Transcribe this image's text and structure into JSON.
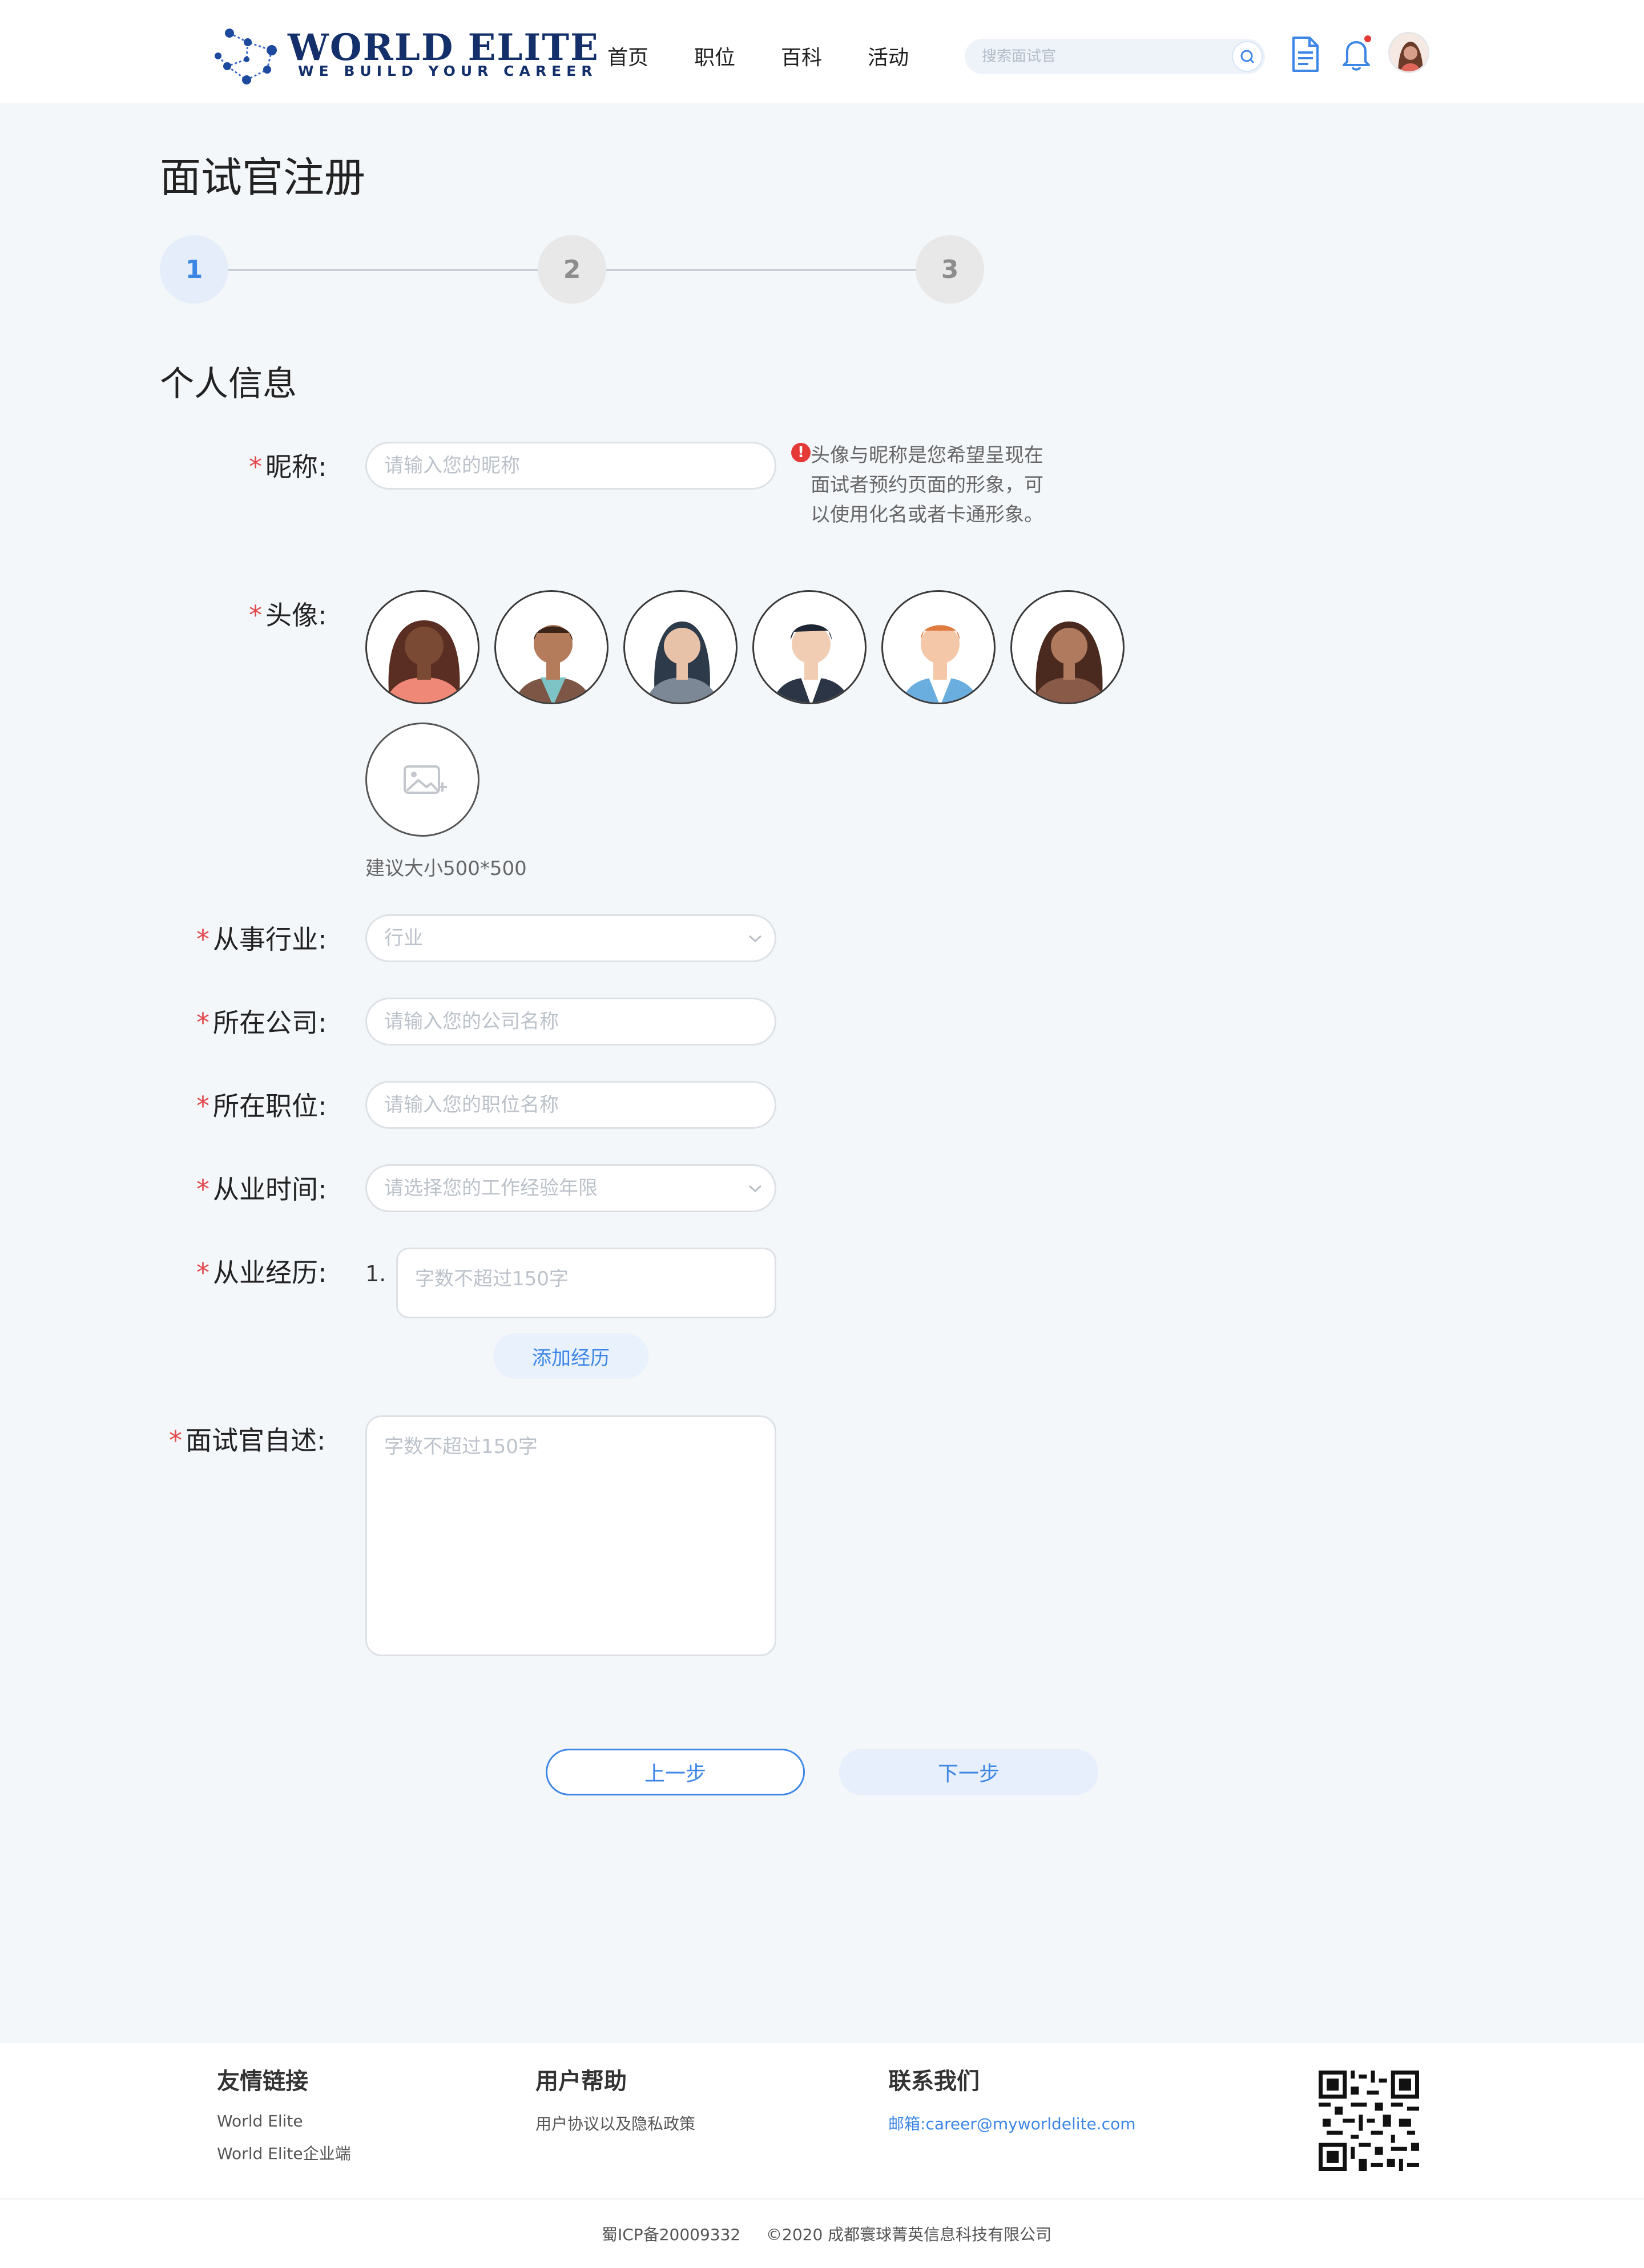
{
  "header": {
    "logo_title": "WORLD ELITE",
    "logo_subtitle": "WE BUILD YOUR CAREER",
    "nav": [
      "首页",
      "职位",
      "百科",
      "活动"
    ],
    "search_placeholder": "搜索面试官"
  },
  "page": {
    "title": "面试官注册",
    "steps": [
      "1",
      "2",
      "3"
    ],
    "active_step": 1,
    "section_title": "个人信息"
  },
  "form": {
    "required_mark": "*",
    "nickname": {
      "label": "昵称:",
      "placeholder": "请输入您的昵称"
    },
    "hint": "头像与昵称是您希望呈现在面试者预约页面的形象，可以使用化名或者卡通形象。",
    "hint_icon": "!",
    "avatar": {
      "label": "头像:",
      "options": [
        "avatar-1",
        "avatar-2",
        "avatar-3",
        "avatar-4",
        "avatar-5",
        "avatar-6"
      ],
      "upload_tip": "建议大小500*500"
    },
    "industry": {
      "label": "从事行业:",
      "placeholder": "行业"
    },
    "company": {
      "label": "所在公司:",
      "placeholder": "请输入您的公司名称"
    },
    "position": {
      "label": "所在职位:",
      "placeholder": "请输入您的职位名称"
    },
    "years": {
      "label": "从业时间:",
      "placeholder": "请选择您的工作经验年限"
    },
    "experience": {
      "label": "从业经历:",
      "item_number": "1.",
      "placeholder": "字数不超过150字",
      "add_button": "添加经历"
    },
    "self_intro": {
      "label": "面试官自述:",
      "placeholder": "字数不超过150字"
    }
  },
  "actions": {
    "prev": "上一步",
    "next": "下一步"
  },
  "footer": {
    "links_title": "友情链接",
    "links": [
      "World Elite",
      "World Elite企业端"
    ],
    "help_title": "用户帮助",
    "help_links": [
      "用户协议以及隐私政策"
    ],
    "contact_title": "联系我们",
    "email_label": "邮箱:",
    "email": "career@myworldelite.com",
    "icp": "蜀ICP备20009332",
    "copyright": "©2020 成都寰球菁英信息科技有限公司"
  },
  "colors": {
    "accent": "#3d86e6",
    "brand": "#14306b",
    "required": "#e2484c",
    "background": "#f4f7fa"
  }
}
